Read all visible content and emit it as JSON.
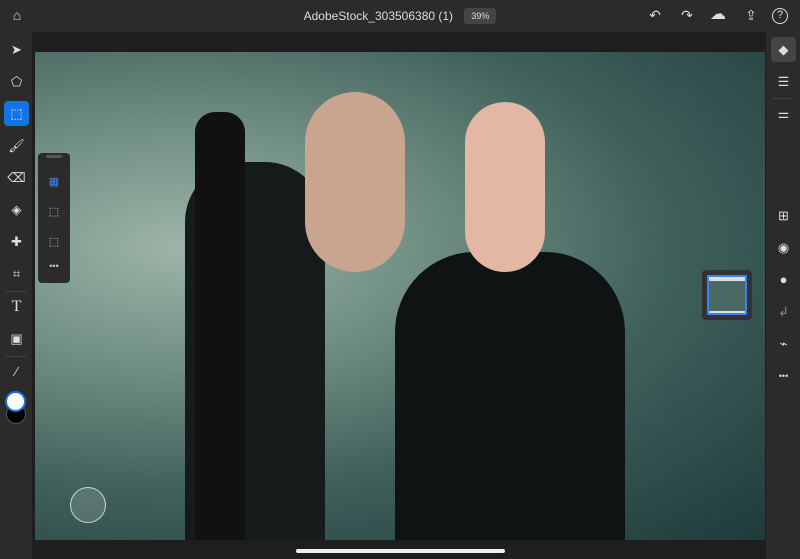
{
  "header": {
    "title": "AdobeStock_303506380 (1)",
    "zoom": "39%"
  },
  "icons": {
    "home": "⌂",
    "undo": "↶",
    "redo": "↷",
    "cloud": "☁",
    "share": "⇪",
    "help": "?"
  },
  "left_tools": [
    {
      "name": "move",
      "glyph": "➤"
    },
    {
      "name": "transform",
      "glyph": "⬠"
    },
    {
      "name": "selection",
      "glyph": "⬚"
    },
    {
      "name": "brush",
      "glyph": "🖌"
    },
    {
      "name": "eraser",
      "glyph": "⌫"
    },
    {
      "name": "fill",
      "glyph": "◈"
    },
    {
      "name": "healing",
      "glyph": "✚"
    },
    {
      "name": "crop",
      "glyph": "⌗"
    },
    {
      "name": "type",
      "glyph": "T"
    },
    {
      "name": "place-image",
      "glyph": "▣"
    },
    {
      "name": "eyedropper",
      "glyph": "⁄"
    }
  ],
  "sub_tools": [
    "▦",
    "⬚",
    "⬚",
    "•••"
  ],
  "right_tools": [
    "◆",
    "☰",
    "⚌",
    "⊞",
    "◉",
    "●",
    "↲",
    "⌁",
    "•••"
  ]
}
